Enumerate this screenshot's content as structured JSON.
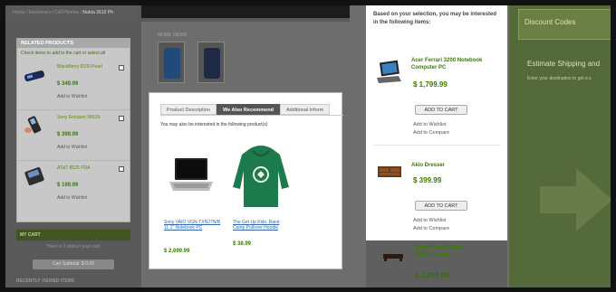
{
  "breadcrumb": {
    "text": "Home / Electronics / Cell Phones /",
    "current": "Nokia 2610 Ph"
  },
  "related": {
    "title": "RELATED PRODUCTS",
    "note": "Check items to add to the cart or select all",
    "items": [
      {
        "name": "BlackBerry 8100 Pearl",
        "price": "$ 349.99",
        "wishlist": "Add to Wishlist"
      },
      {
        "name": "Sony Ericsson W810i",
        "price": "$ 399.99",
        "wishlist": "Add to Wishlist"
      },
      {
        "name": "AT&T 8525 PDA",
        "price": "$ 199.99",
        "wishlist": "Add to Wishlist"
      }
    ]
  },
  "cart": {
    "title": "MY CART",
    "text": "There is 1 item in your cart.",
    "subtotal": "Cart Subtotal: $ 0.00"
  },
  "recently": "RECENTLY VIEWED ITEMS",
  "more_views": "MORE VIEWS",
  "popup": {
    "tabs": [
      "Product Description",
      "We Also Recommend",
      "Additional Inform"
    ],
    "note": "You may also be interested in the following product(s)",
    "products": [
      {
        "name": "Sony VAIO VGN-TXN27N/B 11.1\" Notebook PC",
        "price": "$ 2,699.99"
      },
      {
        "name": "The Get Up Kids: Band Camp Pullover Hoodie",
        "price": "$ 38.99"
      }
    ]
  },
  "recommend": {
    "title": "Based on your selection, you may be interested in the following items:",
    "items": [
      {
        "name": "Acer Ferrari 3200 Notebook Computer PC",
        "price": "$ 1,799.99",
        "add_to_cart": "ADD TO CART",
        "wishlist": "Add to Wishlist",
        "compare": "Add to Compare"
      },
      {
        "name": "Akio Dresser",
        "price": "$ 399.99",
        "add_to_cart": "ADD TO CART",
        "wishlist": "Add to Wishlist",
        "compare": "Add to Compare"
      }
    ],
    "below": {
      "name": "Barcelona Bamboo Platform Bed",
      "price": "$ 2,299.00"
    }
  },
  "sidebar_right": {
    "discount": "Discount Codes",
    "shipping_title": "Estimate Shipping and",
    "shipping_sub": "Enter your destination to get a s"
  },
  "colors": {
    "accent_green": "#3b7a00",
    "tab_active": "#555555"
  }
}
